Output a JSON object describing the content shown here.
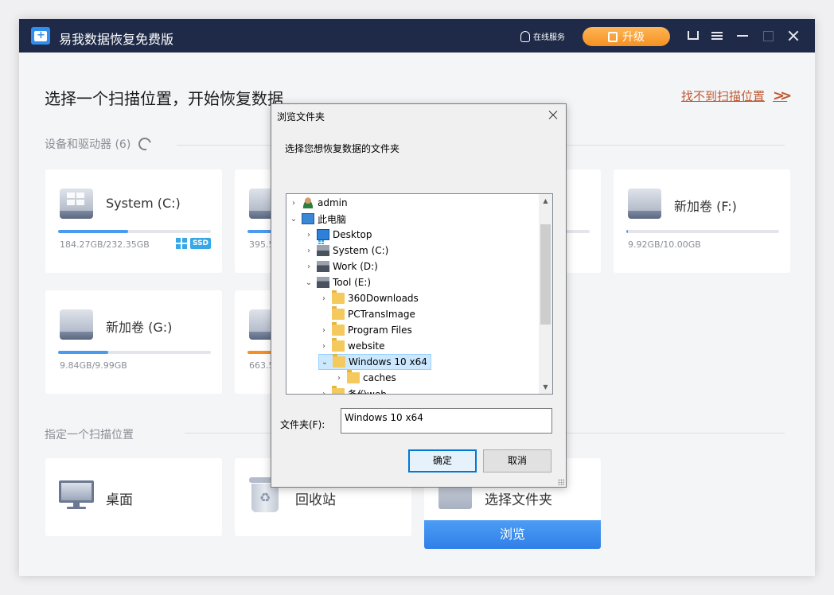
{
  "app": {
    "title": "易我数据恢复免费版",
    "online_service": "在线服务",
    "upgrade_label": "升级",
    "colors": {
      "titlebar": "#1e2a47",
      "accent": "#2f7fe8",
      "upgrade": "#f49022",
      "link": "#c05a33"
    }
  },
  "main": {
    "heading": "选择一个扫描位置，开始恢复数据",
    "cant_find_link": "找不到扫描位置",
    "devices_section": "设备和驱动器 (6)",
    "specify_section": "指定一个扫描位置"
  },
  "drives": [
    {
      "name": "System (C:)",
      "size": "184.27GB/232.35GB",
      "usage": 0.46,
      "color": "#4a9af0",
      "badges": [
        "windows-icon",
        "SSD"
      ]
    },
    {
      "name": "",
      "size": "395.5",
      "usage": 0,
      "color": "#4a9af0"
    },
    {
      "name": "",
      "size": "",
      "usage": 0,
      "color": "#4a9af0"
    },
    {
      "name": "新加卷 (F:)",
      "size": "9.92GB/10.00GB",
      "usage": 0.01,
      "color": "#4a9af0"
    },
    {
      "name": "新加卷 (G:)",
      "size": "9.84GB/9.99GB",
      "usage": 0.33,
      "color": "#4a9af0"
    },
    {
      "name": "",
      "size": "663.5",
      "usage": 0.18,
      "color": "#f49022"
    }
  ],
  "locations": [
    {
      "name": "桌面",
      "icon": "monitor-icon"
    },
    {
      "name": "回收站",
      "icon": "recycle-bin-icon"
    },
    {
      "name": "选择文件夹",
      "icon": "folder-icon",
      "button": "浏览"
    }
  ],
  "dialog": {
    "title": "浏览文件夹",
    "prompt": "选择您想恢复数据的文件夹",
    "tree": [
      {
        "label": "admin",
        "expander": ">",
        "icon": "user",
        "level": 0
      },
      {
        "label": "此电脑",
        "expander": "v",
        "icon": "pc",
        "level": 0
      },
      {
        "label": "Desktop",
        "expander": ">",
        "icon": "desktop",
        "level": 1
      },
      {
        "label": "System (C:)",
        "expander": ">",
        "icon": "sysdrive",
        "level": 1
      },
      {
        "label": "Work (D:)",
        "expander": ">",
        "icon": "drive",
        "level": 1
      },
      {
        "label": "Tool (E:)",
        "expander": "v",
        "icon": "drive",
        "level": 1
      },
      {
        "label": "360Downloads",
        "expander": ">",
        "icon": "folder",
        "level": 2
      },
      {
        "label": "PCTransImage",
        "expander": "",
        "icon": "folder",
        "level": 2
      },
      {
        "label": "Program Files",
        "expander": ">",
        "icon": "folder",
        "level": 2
      },
      {
        "label": "website",
        "expander": ">",
        "icon": "folder",
        "level": 2
      },
      {
        "label": "Windows 10 x64",
        "expander": "v",
        "icon": "folder",
        "level": 2,
        "selected": true
      },
      {
        "label": "caches",
        "expander": ">",
        "icon": "folder",
        "level": 3
      },
      {
        "label": "备份web",
        "expander": ">",
        "icon": "folder",
        "level": 2
      }
    ],
    "folder_label": "文件夹(F):",
    "folder_value": "Windows 10 x64",
    "ok_label": "确定",
    "cancel_label": "取消"
  }
}
